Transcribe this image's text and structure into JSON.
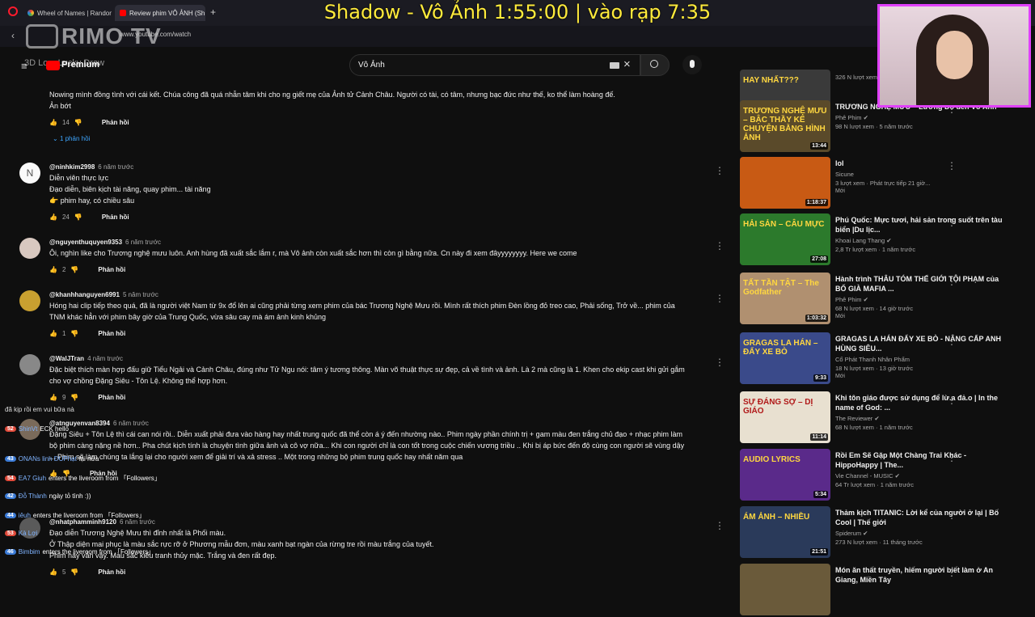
{
  "overlay": {
    "title": "Shadow - Vô Ảnh  1:55:00 | vào rạp 7:35"
  },
  "browser": {
    "tabs": [
      {
        "label": "Wheel of Names | Random",
        "active": false
      },
      {
        "label": "Review phim VÔ ẢNH (Sh",
        "active": true
      }
    ],
    "new_tab": "+",
    "url": "www.youtube.com/watch",
    "watermark": "RIMO TV",
    "lucky_draw": "3D Lo... Lucky Draw"
  },
  "youtube": {
    "premium_label": "Premium",
    "search_value": "Vô Ảnh"
  },
  "comments": [
    {
      "author": "",
      "time": "",
      "text": "Nowing mình đồng tình với cái kết. Chúa công đã quá nhẫn tâm khi cho ng giết mẹ của Ảnh tử Cảnh Châu. Người có tài, có tâm, nhưng bạc đức như thế, ko thể làm hoàng đế.\nẢn bớt",
      "likes": "14",
      "reply_label": "Phản hồi",
      "replies": "1 phản hồi"
    },
    {
      "author": "@ninhkim2998",
      "time": "6 năm trước",
      "text": "Diễn viên thực lực\nĐạo diễn, biên kịch tài năng, quay phim... tài năng\n👉 phim hay, có chiều sâu",
      "likes": "24",
      "reply_label": "Phản hồi"
    },
    {
      "author": "@nguyenthuquyen9353",
      "time": "6 năm trước",
      "text": "Ôi, nghìn like cho Trương nghệ mưu luôn. Anh hùng đã xuất sắc lắm r, mà Vô ảnh còn xuất sắc hơn thì còn gì bằng nữa. Cn này đi xem đâyyyyyyyy. Here we come",
      "likes": "2",
      "reply_label": "Phản hồi"
    },
    {
      "author": "@khanhhanguyen6991",
      "time": "5 năm trước",
      "text": "Hóng hai clip tiếp theo quá, đã là người việt Nam từ 9x đổ lên ai cũng phải từng xem phim của bác Trương Nghệ Mưu rồi. Mình rất thích phim Đèn lồng đỏ treo cao, Phải sống, Trở về... phim của\nTNM khác hẳn với phim bây giờ của Trung Quốc, vừa sâu cay mà ám ảnh kinh khủng",
      "likes": "1",
      "reply_label": "Phản hồi"
    },
    {
      "author": "@WalJTran",
      "time": "4 năm trước",
      "text": "Đặc biệt thích màn hợp đấu giữ Tiểu Ngải và Cảnh Châu, đúng như Tử Ngu nói: tâm ý tương thông. Màn võ thuật thực sự đẹp, cả về tình và ảnh. Là 2 mà cũng là 1. Khen cho ekip cast khi gửi gắm\ncho vợ chồng Đặng Siêu - Tôn Lệ. Không thể hợp hơn.",
      "likes": "9",
      "reply_label": "Phản hồi"
    },
    {
      "author": "@atnguyenvan8394",
      "time": "6 năm trước",
      "text": "Đặng Siêu + Tôn Lệ thì cái can nói rồi.. Diễn xuất phải đưa vào hàng hay nhất trung quốc đã thể còn á ý đến nhường nào.. Phim ngày phần chính trị + gam màu đen trắng chủ đạo + nhạc phim  làm\nbộ phim càng nặng nề hơn.. Pha chút kịch tính là chuyện tình giữa ảnh và cô vợ nữa... Khi con người chỉ là con tốt trong cuộc chiến vương triều .. Khi bị áp bức đến độ cùng con người sẽ vùng dậy\n... Phim sẽ làm chúng ta lắng lại cho người xem để giải trí và xả stress .. Một trong những bộ phim trung quốc hay nhất năm qua",
      "likes": "",
      "reply_label": "Phản hồi"
    },
    {
      "author": "@nhatphamminh9120",
      "time": "6 năm trước",
      "text": "Đạo diễn Trương Nghệ Mưu thì đỉnh nhất là Phối  màu.\nỞ Thập diện mai phục là màu sắc rực rỡ ở Phương  mẫu đơn, màu xanh bạt ngàn của rừng tre rồi  màu trắng của tuyết.\nPhim này vẫn vậy. Màu sắc kiểu tranh thủy mặc. Trắng và đen rất đẹp.",
      "likes": "5",
      "reply_label": "Phản hồi"
    }
  ],
  "sidebar": [
    {
      "title": "",
      "channel": "",
      "meta": "326 N lượt xem · 5 năm trước",
      "badge": "",
      "duration": "17:52",
      "thumb_text": "HAY NHẤT???",
      "color": "#3a3a3a"
    },
    {
      "title": "TRƯƠNG NGHỆ MƯU – Lương Đỏ đến Vô Ảnh",
      "channel": "Phê Phim ✔",
      "meta": "98 N lượt xem · 5 năm trước",
      "badge": "",
      "duration": "13:44",
      "thumb_text": "TRƯƠNG NGHỆ MƯU – BẬC THẦY KỂ CHUYỆN BẰNG HÌNH ẢNH",
      "color": "#5a4a2a"
    },
    {
      "title": "lol",
      "channel": "Sicune",
      "meta": "3 lượt xem · Phát trực tiếp 21 giờ...",
      "badge": "Mới",
      "duration": "1:18:37",
      "thumb_text": "",
      "color": "#c85a14"
    },
    {
      "title": "Phú Quốc: Mực tươi, hải sản trong suốt trên tàu biển |Du lịc...",
      "channel": "Khoai Lang Thang ✔",
      "meta": "2,8 Tr lượt xem · 1 năm trước",
      "badge": "",
      "duration": "27:08",
      "thumb_text": "HẢI SẢN – CÂU MỰC",
      "color": "#2c7a2c"
    },
    {
      "title": "Hành trình THÂU TÓM THẾ GIỚI TỘI PHẠM của BỐ GIÀ MAFIA ...",
      "channel": "Phê Phim ✔",
      "meta": "68 N lượt xem · 14 giờ trước",
      "badge": "Mới",
      "duration": "1:03:32",
      "thumb_text": "TẤT TẦN TẬT – The Godfather",
      "color": "#b09070"
    },
    {
      "title": "GRAGAS LA HÁN ĐẨY XE BÒ - NÂNG CẤP ANH HÙNG SIÊU...",
      "channel": "Cổ Phát Thanh Nhân Phẩm",
      "meta": "18 N lượt xem · 13 giờ trước",
      "badge": "Mới",
      "duration": "9:33",
      "thumb_text": "GRAGAS LA HÁN – ĐẨY XE BÒ",
      "color": "#3a4a8a"
    },
    {
      "title": "Khi tôn giáo được sử dụng để lừ.a đả.o | In the name of God: ...",
      "channel": "The Reviewer ✔",
      "meta": "68 N lượt xem · 1 năm trước",
      "badge": "",
      "duration": "11:14",
      "thumb_text": "SỰ ĐÁNG SỢ – DỊ GIÁO",
      "color": "#e8e0d0"
    },
    {
      "title": "Rồi Em Sẽ Gặp Một Chàng Trai Khác - HippoHappy | The...",
      "channel": "Vie Channel - MUSIC ✔",
      "meta": "64 Tr lượt xem · 1 năm trước",
      "badge": "",
      "duration": "5:34",
      "thumb_text": "AUDIO LYRICS",
      "color": "#5a2a8a"
    },
    {
      "title": "Thảm kịch TITANIC: Lời kể của người ở lại | Bố Cool | Thế giới",
      "channel": "Spiderum ✔",
      "meta": "273 N lượt xem · 11 tháng trước",
      "badge": "",
      "duration": "21:51",
      "thumb_text": "ÁM ẢNH – NHIỀU",
      "color": "#2a3a5a"
    },
    {
      "title": "Món ăn thất truyền, hiếm người biết làm ở An Giang, Miền Tây",
      "channel": "",
      "meta": "",
      "badge": "",
      "duration": "",
      "thumb_text": "",
      "color": "#6a5a3a"
    }
  ],
  "chat": [
    {
      "level": "",
      "user": "",
      "text": "đã kịp rồi em vui bữa nà",
      "red": false
    },
    {
      "level": "52",
      "user": "ShinVt",
      "text": "ECK hello",
      "red": true
    },
    {
      "level": "43",
      "user": "ONANs linh ĐUPhạt",
      "text": "lại nửa",
      "red": false
    },
    {
      "level": "54",
      "user": "EA7 Giuh",
      "text": "enters the liveroom from 「Followers」",
      "red": true
    },
    {
      "level": "42",
      "user": "Đỗ Thành",
      "text": "ngày tỏ tình :))",
      "red": false
    },
    {
      "level": "44",
      "user": "iêuh",
      "text": "enters the liveroom from 「Followers」",
      "red": false
    },
    {
      "level": "53",
      "user": "Kà Lợi",
      "text": "",
      "red": true
    },
    {
      "level": "46",
      "user": "Bimbim",
      "text": "enters the liveroom from 「Followers」",
      "red": false
    }
  ]
}
